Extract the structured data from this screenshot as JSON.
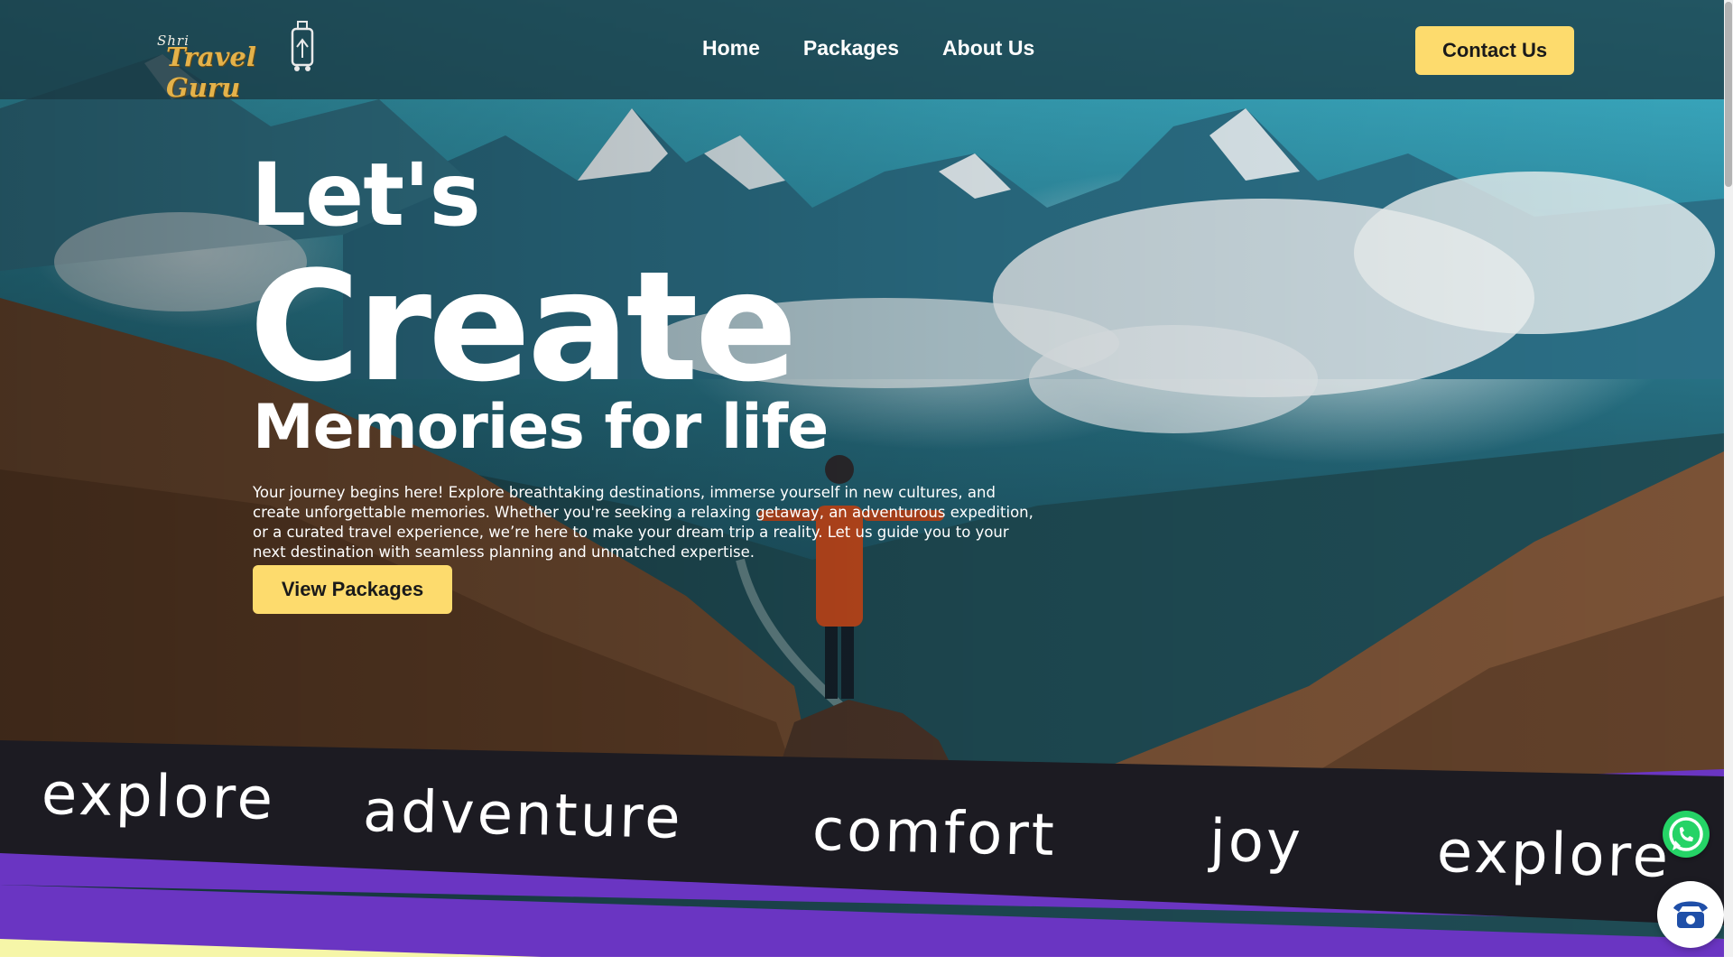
{
  "header": {
    "logo": {
      "prefix": "Shri",
      "name": "Travel Guru"
    },
    "nav": [
      {
        "label": "Home"
      },
      {
        "label": "Packages"
      },
      {
        "label": "About Us"
      }
    ],
    "contact_label": "Contact Us"
  },
  "hero": {
    "line1": "Let's",
    "line2": "Create",
    "line3": "Memories for life",
    "description": "Your journey begins here! Explore breathtaking destinations, immerse yourself in new cultures, and create unforgettable memories. Whether you're seeking a relaxing getaway, an adventurous expedition, or a curated travel experience, we’re here to make your dream trip a reality. Let us guide you to your next destination with seamless planning and unmatched expertise.",
    "cta_label": "View Packages"
  },
  "ribbon": {
    "words": [
      "explore",
      "adventure",
      "comfort",
      "joy",
      "explore"
    ]
  },
  "floating": {
    "whatsapp_icon": "whatsapp-icon",
    "phone_icon": "telephone-icon"
  },
  "colors": {
    "accent_yellow": "#fddb6d",
    "ribbon_dark": "#1c1b22",
    "ribbon_purple": "#6a35c2",
    "ribbon_cream": "#f6f6a8",
    "whatsapp_green": "#25d366",
    "phone_blue": "#1f4fa8"
  }
}
